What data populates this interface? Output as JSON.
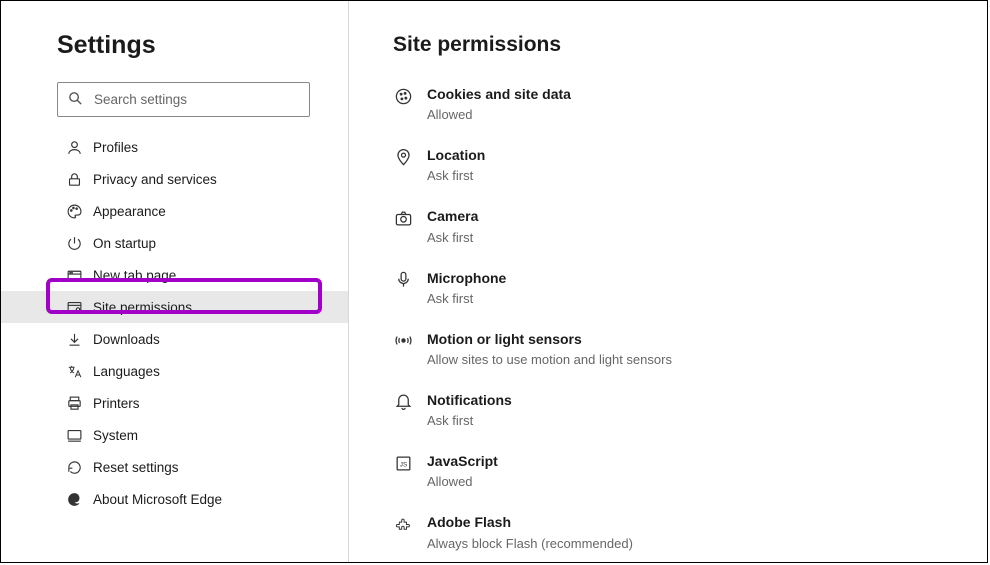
{
  "sidebar": {
    "title": "Settings",
    "search_placeholder": "Search settings",
    "items": [
      {
        "label": "Profiles"
      },
      {
        "label": "Privacy and services"
      },
      {
        "label": "Appearance"
      },
      {
        "label": "On startup"
      },
      {
        "label": "New tab page"
      },
      {
        "label": "Site permissions"
      },
      {
        "label": "Downloads"
      },
      {
        "label": "Languages"
      },
      {
        "label": "Printers"
      },
      {
        "label": "System"
      },
      {
        "label": "Reset settings"
      },
      {
        "label": "About Microsoft Edge"
      }
    ]
  },
  "main": {
    "title": "Site permissions",
    "permissions": [
      {
        "title": "Cookies and site data",
        "sub": "Allowed"
      },
      {
        "title": "Location",
        "sub": "Ask first"
      },
      {
        "title": "Camera",
        "sub": "Ask first"
      },
      {
        "title": "Microphone",
        "sub": "Ask first"
      },
      {
        "title": "Motion or light sensors",
        "sub": "Allow sites to use motion and light sensors"
      },
      {
        "title": "Notifications",
        "sub": "Ask first"
      },
      {
        "title": "JavaScript",
        "sub": "Allowed"
      },
      {
        "title": "Adobe Flash",
        "sub": "Always block Flash (recommended)"
      }
    ]
  }
}
